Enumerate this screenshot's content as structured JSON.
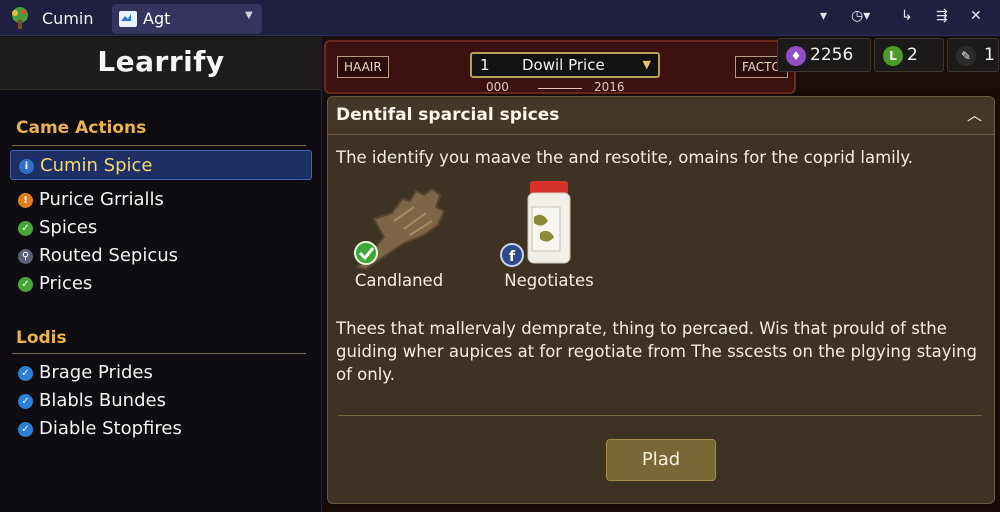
{
  "window": {
    "app_title": "Cumin",
    "tab_label": "Agt"
  },
  "sidebar": {
    "logo": "Learrify",
    "sections": [
      {
        "title": "Came Actions",
        "items": [
          {
            "label": "Cumin Spice",
            "icon": "info-icon",
            "color": "#2f6fc8",
            "active": true
          },
          {
            "label": "Purice Grrialls",
            "icon": "alert-icon",
            "color": "#e07b22",
            "active": false
          },
          {
            "label": "Spices",
            "icon": "check-icon",
            "color": "#48a43a",
            "active": false
          },
          {
            "label": "Routed Sepicus",
            "icon": "runner-icon",
            "color": "#5a5f7a",
            "active": false
          },
          {
            "label": "Prices",
            "icon": "check-icon",
            "color": "#48a43a",
            "active": false
          }
        ]
      },
      {
        "title": "Lodis",
        "items": [
          {
            "label": "Brage Prides",
            "icon": "check-icon",
            "color": "#2b7fd6",
            "active": false
          },
          {
            "label": "Blabls Bundes",
            "icon": "check-icon",
            "color": "#2b7fd6",
            "active": false
          },
          {
            "label": "Diable Stopfires",
            "icon": "check-icon",
            "color": "#2b7fd6",
            "active": false
          }
        ]
      }
    ]
  },
  "game": {
    "banner_left": "HAAIR",
    "banner_right": "FACTO",
    "price_select": {
      "number": "1",
      "label": "Dowil Price"
    },
    "range": {
      "start": "000",
      "end": "2016"
    }
  },
  "resources": [
    {
      "value": "2256",
      "icon": "gem-icon",
      "color": "#8e4fc4"
    },
    {
      "value": "2",
      "icon": "level-icon",
      "color": "#4c9a2a"
    },
    {
      "value": "1",
      "icon": "tool-icon",
      "color": "#2b2b2b"
    }
  ],
  "dialog": {
    "title": "Dentifal sparcial spices",
    "intro": "The identify you maave the and resotite, omains for the coprid lamily.",
    "cards": [
      {
        "label": "Candlaned",
        "icon": "hand-icon",
        "badge": "check-badge-icon"
      },
      {
        "label": "Negotiates",
        "icon": "spice-jar-icon",
        "badge": "facebook-badge-icon"
      }
    ],
    "body": "Thees that mallervaly demprate, thing to percaed. Wis that prould of sthe guiding wher aupices at for regotiate from The sscests on the plgying staying of only.",
    "button_label": "Plad"
  }
}
